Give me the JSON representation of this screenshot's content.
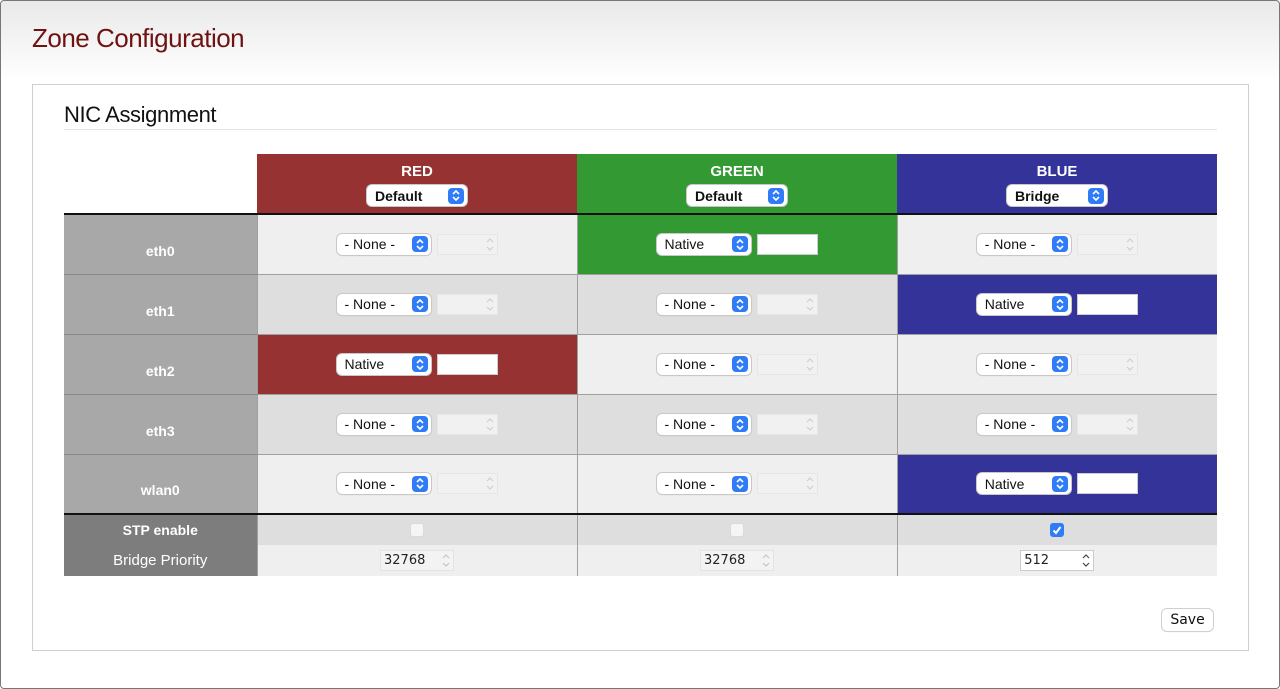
{
  "page": {
    "title": "Zone Configuration"
  },
  "section": {
    "title": "NIC Assignment"
  },
  "zones": [
    {
      "name": "RED",
      "mode": "Default",
      "color": "#963232"
    },
    {
      "name": "GREEN",
      "mode": "Default",
      "color": "#339933"
    },
    {
      "name": "BLUE",
      "mode": "Bridge",
      "color": "#333399"
    }
  ],
  "nics": [
    {
      "name": "eth0",
      "assign": [
        "- None -",
        "Native",
        "- None -"
      ]
    },
    {
      "name": "eth1",
      "assign": [
        "- None -",
        "- None -",
        "Native"
      ]
    },
    {
      "name": "eth2",
      "assign": [
        "Native",
        "- None -",
        "- None -"
      ]
    },
    {
      "name": "eth3",
      "assign": [
        "- None -",
        "- None -",
        "- None -"
      ]
    },
    {
      "name": "wlan0",
      "assign": [
        "- None -",
        "- None -",
        "Native"
      ]
    }
  ],
  "stp": {
    "label": "STP enable",
    "values": [
      false,
      false,
      true
    ]
  },
  "bridge_priority": {
    "label": "Bridge Priority",
    "values": [
      "32768",
      "32768",
      "512"
    ]
  },
  "actions": {
    "save": "Save"
  },
  "icons": {
    "select_arrow": "updown-chevron-icon",
    "spinner": "spinner-arrows-icon",
    "checkmark": "checkmark-icon"
  },
  "colors": {
    "title": "#6e1212",
    "accent": "#2f7cf6"
  }
}
